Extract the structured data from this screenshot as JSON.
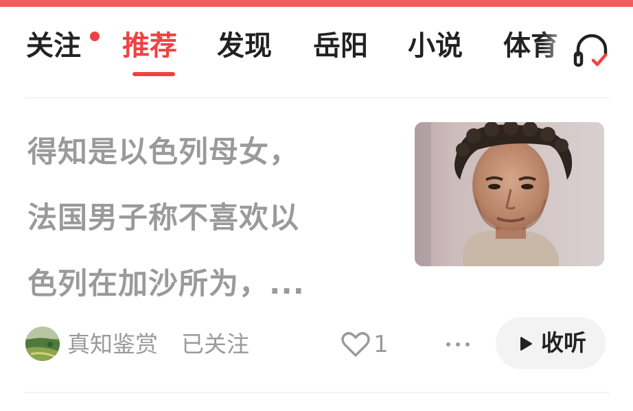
{
  "nav": {
    "tabs": [
      {
        "label": "关注",
        "has_dot": true
      },
      {
        "label": "推荐",
        "active": true
      },
      {
        "label": "发现"
      },
      {
        "label": "岳阳"
      },
      {
        "label": "小说"
      },
      {
        "label": "体育"
      }
    ],
    "accent_color": "#f04142",
    "listen_icon": "headphones-icon"
  },
  "article": {
    "title_lines": [
      "得知是以色列母女，",
      "法国男子称不喜欢以",
      "色列在加沙所为，..."
    ],
    "thumbnail_icon": "portrait-photo",
    "author": "真知鉴赏",
    "follow_status": "已关注",
    "like_count": "1",
    "play_label": "收听"
  }
}
